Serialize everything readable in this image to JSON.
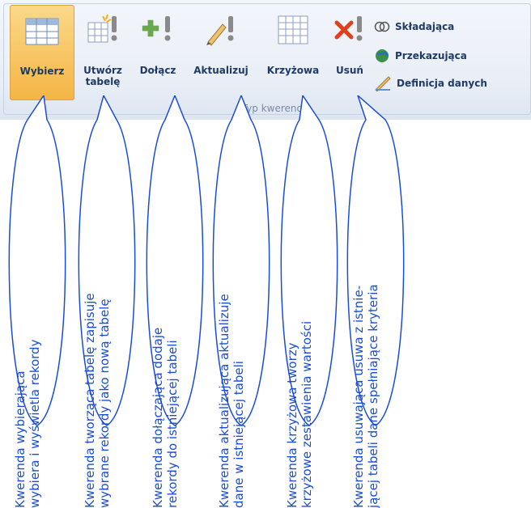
{
  "ribbon": {
    "group_label": "Typ kwerendy",
    "buttons": [
      {
        "id": "select",
        "label": "Wybierz",
        "icon": "select-query-icon"
      },
      {
        "id": "maketable",
        "label": "Utwórz\ntabelę",
        "icon": "make-table-query-icon"
      },
      {
        "id": "append",
        "label": "Dołącz",
        "icon": "append-query-icon"
      },
      {
        "id": "update",
        "label": "Aktualizuj",
        "icon": "update-query-icon"
      },
      {
        "id": "crosstab",
        "label": "Krzyżowa",
        "icon": "crosstab-query-icon"
      },
      {
        "id": "delete",
        "label": "Usuń",
        "icon": "delete-query-icon"
      }
    ],
    "small_buttons": [
      {
        "label": "Składająca",
        "icon": "union-query-icon"
      },
      {
        "label": "Przekazująca",
        "icon": "pass-through-query-icon"
      },
      {
        "label": "Definicja danych",
        "icon": "data-definition-icon"
      }
    ]
  },
  "callouts": [
    {
      "text": "Kwerenda wybierająca\nwybiera i wyświetla rekordy"
    },
    {
      "text": "Kwerenda tworząca tabelę zapisuje\nwybrane rekordy jako nową tabelę"
    },
    {
      "text": "Kwerenda dołączająca dodaje\nrekordy do istniejącej tabeli"
    },
    {
      "text": "Kwerenda aktualizująca aktualizuje\ndane w istniejącej tabeli"
    },
    {
      "text": "Kwerenda krzyżowa  tworzy\nkrzyżowe  zestawienia  wartości"
    },
    {
      "text": "Kwerenda usuwająca usuwa z istnie-\njącej tabeli dane spełniające kryteria"
    }
  ],
  "colors": {
    "callout_text": "#1a4dd6",
    "callout_stroke": "#1a4dd6",
    "selected_button": "#f4b545"
  }
}
